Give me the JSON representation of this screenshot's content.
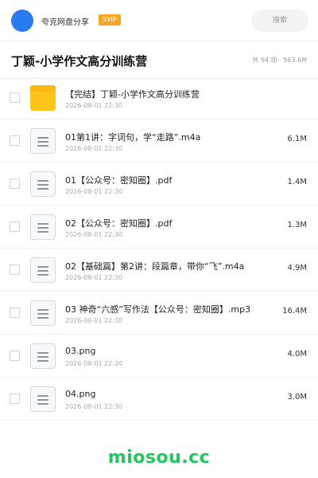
{
  "header": {
    "username": "夸克网盘分享",
    "badge": "SVIP",
    "search_label": "搜索"
  },
  "folder": {
    "title": "丁颖-小学作文高分训练营",
    "meta": "共 94 项 · 563.6M"
  },
  "files": [
    {
      "type": "folder",
      "name": "【完结】丁颖-小学作文高分训练营",
      "date": "2026-08-01 22:30",
      "size": ""
    },
    {
      "type": "file",
      "name": "01第1讲：字词句，学“走路”.m4a",
      "date": "2026-08-01 22:30",
      "size": "6.1M"
    },
    {
      "type": "file",
      "name": "01【公众号：密知圈】.pdf",
      "date": "2026-08-01 22:30",
      "size": "1.4M"
    },
    {
      "type": "file",
      "name": "02【公众号：密知圈】.pdf",
      "date": "2026-08-01 22:30",
      "size": "1.3M"
    },
    {
      "type": "file",
      "name": "02【基础篇】第2讲：段篇章，带你“飞”.m4a",
      "date": "2026-08-01 22:30",
      "size": "4.9M"
    },
    {
      "type": "file",
      "name": "03 神奇“六感”写作法【公众号：密知圈】.mp3",
      "date": "2026-08-01 22:30",
      "size": "16.4M"
    },
    {
      "type": "file",
      "name": "03.png",
      "date": "2026-08-01 22:30",
      "size": "4.0M"
    },
    {
      "type": "file",
      "name": "04.png",
      "date": "2026-08-01 22:30",
      "size": "3.0M"
    }
  ],
  "watermark": "miosou.cc",
  "colors": {
    "avatar": "#2b7bf0",
    "svip_badge": "#f5a623",
    "folder_icon": "#fcc419",
    "watermark": "#22c55e"
  }
}
